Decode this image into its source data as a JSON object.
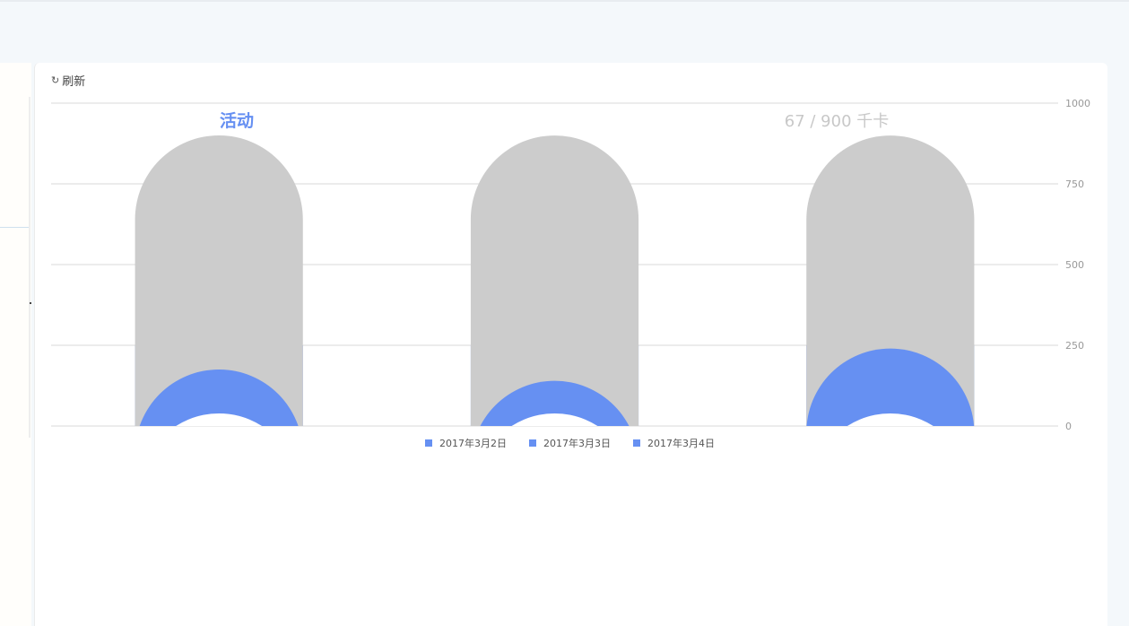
{
  "toolbar": {
    "refresh_icon": "↻",
    "refresh_label": "刷新"
  },
  "chart_data": {
    "type": "bar",
    "title": "活动",
    "annotation": "67 / 900 千卡",
    "categories": [
      "2017年3月2日",
      "2017年3月3日",
      "2017年3月4日"
    ],
    "background_value": 900,
    "values": [
      175,
      140,
      240
    ],
    "ylim": [
      0,
      1000
    ],
    "yticks": [
      0,
      250,
      500,
      750,
      1000
    ],
    "y_axis_position": "right",
    "grid": true,
    "legend_position": "bottom-center",
    "colors": {
      "series": "#6690f2",
      "background": "#cccccc",
      "grid": "#e5e5e5",
      "axis_text": "#999999",
      "title": "#6690f2",
      "annotation": "#c8c8c8"
    }
  }
}
